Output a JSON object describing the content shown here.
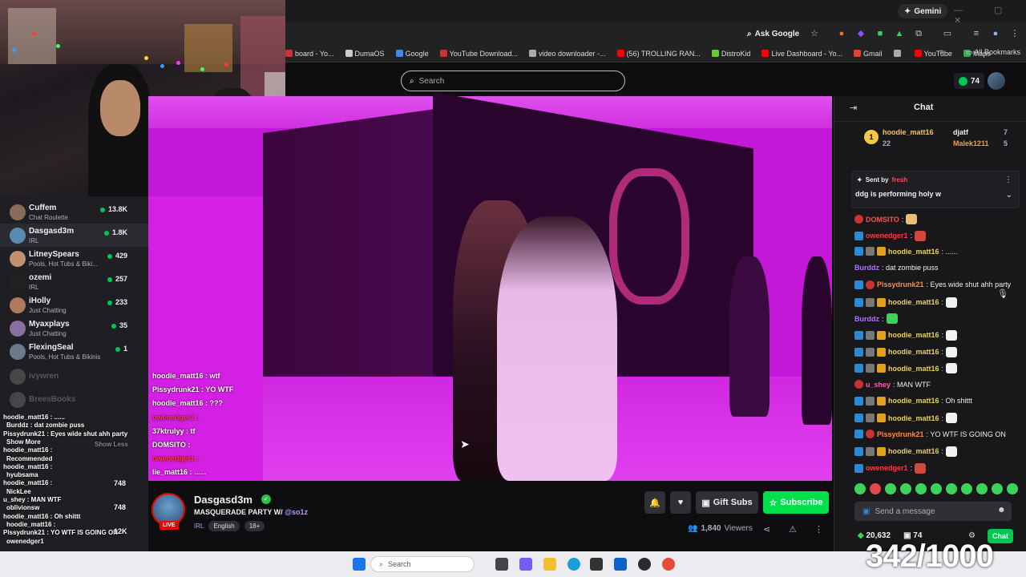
{
  "browser": {
    "gemini_label": "Gemini",
    "ask_google": "Ask Google",
    "window_controls": "—  ▢  ✕",
    "bookmarks": [
      {
        "label": "board - Yo...",
        "color": "#cc3333"
      },
      {
        "label": "DumaOS",
        "color": "#cccccc"
      },
      {
        "label": "Google",
        "color": "#4285f4"
      },
      {
        "label": "YouTube Download...",
        "color": "#cc3333"
      },
      {
        "label": "video downloader -...",
        "color": "#aaaaaa"
      },
      {
        "label": "(56) TROLLING RAN...",
        "color": "#ff0000"
      },
      {
        "label": "DistroKid",
        "color": "#66cc33"
      },
      {
        "label": "Live Dashboard - Yo...",
        "color": "#ff0000"
      },
      {
        "label": "Gmail",
        "color": "#dd4433"
      },
      {
        "label": "",
        "color": "#aaaaaa"
      },
      {
        "label": "YouTube",
        "color": "#ff0000"
      },
      {
        "label": "Maps",
        "color": "#34a853"
      }
    ],
    "all_bookmarks": "All Bookmarks"
  },
  "nav": {
    "search_placeholder": "Search",
    "points": "74"
  },
  "sidebar": {
    "channels": [
      {
        "name": "Cuffem",
        "category": "Chat Roulette",
        "viewers": "13.8K",
        "color": "#8a6a5a",
        "live": "green"
      },
      {
        "name": "Dasgasd3m",
        "category": "IRL",
        "viewers": "1.8K",
        "color": "#5a8ab0",
        "live": "green"
      },
      {
        "name": "LitneySpears",
        "category": "Pools, Hot Tubs & Biki...",
        "viewers": "429",
        "color": "#c09070",
        "live": "green"
      },
      {
        "name": "ozemi",
        "category": "IRL",
        "viewers": "257",
        "color": "#222222",
        "live": "green"
      },
      {
        "name": "iHolly",
        "category": "Just Chatting",
        "viewers": "233",
        "color": "#b07a60",
        "live": "green"
      },
      {
        "name": "Myaxplays",
        "category": "Just Chatting",
        "viewers": "35",
        "color": "#8870a0",
        "live": "green"
      },
      {
        "name": "FlexingSeal",
        "category": "Pools, Hot Tubs & Bikinis",
        "viewers": "1",
        "color": "#6a7a8a",
        "live": "green"
      }
    ],
    "offline": [
      "ivywren",
      "BreesBooks"
    ],
    "overlay_chat": [
      "hoodie_matt16 : ......",
      "Burddz : dat zombie puss",
      "Pissydrunk21 : Eyes wide shut ahh party",
      "Show More",
      "hoodie_matt16 :",
      "Recommended",
      "hoodie_matt16 :",
      "hyubsama",
      "hoodie_matt16 :",
      "NickLee",
      "u_shey : MAN WTF",
      "oblivionsw",
      "hoodie_matt16 : Oh shittt",
      "hoodie_matt16 :",
      "Pissydrunk21 : YO WTF IS GOING ON",
      "owenedger1"
    ],
    "overlay_counts": [
      "748",
      "748",
      "12K"
    ],
    "show_less": "Show Less"
  },
  "video_chat": [
    "hoodie_matt16 : wtf",
    "Pissydrunk21 : YO WTF",
    "hoodie_matt16 : ???",
    "owenedger1 :",
    "37ktrulyy : tf",
    "DOMSITO :",
    "owenedger1 :",
    "lie_matt16 : ......"
  ],
  "stream": {
    "channel": "Dasgasd3m",
    "live": "LIVE",
    "title": "MASQUERADE PARTY W/ ",
    "title_mention": "@so1z",
    "category": "IRL",
    "tags": [
      "English",
      "18+"
    ],
    "gift_subs": "Gift Subs",
    "subscribe": "Subscribe",
    "viewers": "1,840",
    "viewers_label": "Viewers"
  },
  "chat": {
    "title": "Chat",
    "leaderboard": [
      {
        "name": "hoodie_matt16",
        "score": "22"
      },
      {
        "name": "djatf",
        "score": "7"
      },
      {
        "name": "Malek1211",
        "score": "5"
      }
    ],
    "pinned_by": "Sent by",
    "pinned_user": "fresh",
    "pinned_text": "ddg is performing holy w",
    "messages": [
      {
        "user": "DOMSITO",
        "text": ":",
        "color": "#ff4f4f",
        "badges": [
          "red"
        ],
        "emote": "#e8c070"
      },
      {
        "user": "owenedger1",
        "text": ":",
        "color": "#ff3c3c",
        "badges": [
          "blue"
        ],
        "emote": "#d04a3a"
      },
      {
        "user": "hoodie_matt16",
        "text": ": ......",
        "color": "#e8d060",
        "badges": [
          "blue",
          "grey",
          "gold"
        ],
        "emote": ""
      },
      {
        "user": "Burddz",
        "text": ": dat zombie puss",
        "color": "#b070ff",
        "badges": [],
        "emote": ""
      },
      {
        "user": "Pissydrunk21",
        "text": ": Eyes wide shut ahh party",
        "color": "#ff8a3a",
        "badges": [
          "blue",
          "red"
        ],
        "emote": ""
      },
      {
        "user": "hoodie_matt16",
        "text": ":",
        "color": "#e8d060",
        "badges": [
          "blue",
          "grey",
          "gold"
        ],
        "emote": "#f2f2f2"
      },
      {
        "user": "Burddz",
        "text": ":",
        "color": "#b070ff",
        "badges": [],
        "emote": "#3bd35a"
      },
      {
        "user": "hoodie_matt16",
        "text": ":",
        "color": "#e8d060",
        "badges": [
          "blue",
          "grey",
          "gold"
        ],
        "emote": "#f2f2f2"
      },
      {
        "user": "hoodie_matt16",
        "text": ":",
        "color": "#e8d060",
        "badges": [
          "blue",
          "grey",
          "gold"
        ],
        "emote": "#f2f2f2"
      },
      {
        "user": "hoodie_matt16",
        "text": ":",
        "color": "#e8d060",
        "badges": [
          "blue",
          "grey",
          "gold"
        ],
        "emote": "#f2f2f2"
      },
      {
        "user": "u_shey",
        "text": ": MAN WTF",
        "color": "#ff5ab8",
        "badges": [
          "red"
        ],
        "emote": ""
      },
      {
        "user": "hoodie_matt16",
        "text": ": Oh shittt",
        "color": "#e8d060",
        "badges": [
          "blue",
          "grey",
          "gold"
        ],
        "emote": ""
      },
      {
        "user": "hoodie_matt16",
        "text": ":",
        "color": "#e8d060",
        "badges": [
          "blue",
          "grey",
          "gold"
        ],
        "emote": "#f2f2f2"
      },
      {
        "user": "Pissydrunk21",
        "text": ": YO WTF IS GOING ON",
        "color": "#ff8a3a",
        "badges": [
          "blue",
          "red"
        ],
        "emote": ""
      },
      {
        "user": "hoodie_matt16",
        "text": ":",
        "color": "#e8d060",
        "badges": [
          "blue",
          "grey",
          "gold"
        ],
        "emote": "#f2f2f2"
      },
      {
        "user": "owenedger1",
        "text": ":",
        "color": "#ff3c3c",
        "badges": [
          "blue"
        ],
        "emote": "#d04a3a"
      }
    ],
    "send_placeholder": "Send a message",
    "bits": "20,632",
    "gift_count": "74",
    "chat_button": "Chat"
  },
  "overlay_counter": "342/1000",
  "taskbar": {
    "search_placeholder": "Search"
  }
}
